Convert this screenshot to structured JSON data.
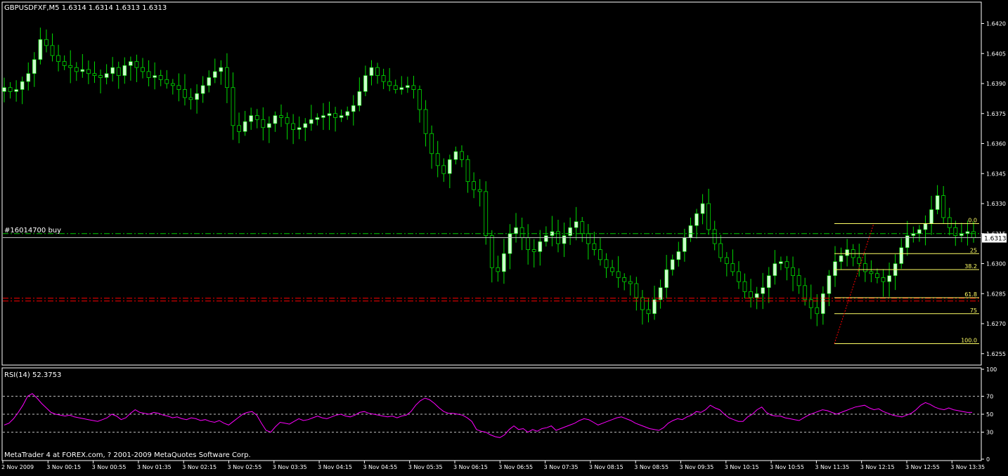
{
  "header": {
    "symbol_label": "GBPUSDFXF,M5  1.6314 1.6314 1.6313 1.6313",
    "footer": "MetaTrader 4 at FOREX.com, ? 2001-2009 MetaQuotes Software Corp."
  },
  "order_label": "#16014700 buy",
  "current_price_label": "1.6313",
  "colors": {
    "background": "#000000",
    "axis": "#ffffff",
    "bull_candle": "#ccffcc",
    "wick": "#00dd00",
    "rsi_line": "#ff00ff",
    "fibo": "#ffff66",
    "order_line": "#00cc00",
    "stop_line": "#ff0000"
  },
  "chart_data": [
    {
      "type": "candlestick",
      "title": "GBPUSDFXF,M5",
      "ylim": [
        1.625,
        1.643
      ],
      "y_ticks": [
        "1.6420",
        "1.6405",
        "1.6390",
        "1.6375",
        "1.6360",
        "1.6345",
        "1.6330",
        "1.6315",
        "1.6300",
        "1.6285",
        "1.6270",
        "1.6255"
      ],
      "x_ticks": [
        "2 Nov 2009",
        "3 Nov 00:15",
        "3 Nov 00:55",
        "3 Nov 01:35",
        "3 Nov 02:15",
        "3 Nov 02:55",
        "3 Nov 03:35",
        "3 Nov 04:15",
        "3 Nov 04:55",
        "3 Nov 05:35",
        "3 Nov 06:15",
        "3 Nov 06:55",
        "3 Nov 07:35",
        "3 Nov 08:15",
        "3 Nov 08:55",
        "3 Nov 09:35",
        "3 Nov 10:15",
        "3 Nov 10:55",
        "3 Nov 11:35",
        "3 Nov 12:15",
        "3 Nov 12:55",
        "3 Nov 13:35"
      ],
      "close_path": [
        1.6388,
        1.6386,
        1.6387,
        1.6391,
        1.6395,
        1.6402,
        1.6412,
        1.6409,
        1.6404,
        1.6401,
        1.6399,
        1.6398,
        1.6396,
        1.6397,
        1.6395,
        1.6394,
        1.6393,
        1.6395,
        1.6398,
        1.6394,
        1.6399,
        1.6401,
        1.6398,
        1.6396,
        1.6393,
        1.6394,
        1.6392,
        1.639,
        1.6389,
        1.6387,
        1.6383,
        1.6382,
        1.6385,
        1.6389,
        1.6393,
        1.6396,
        1.6398,
        1.6388,
        1.6369,
        1.6366,
        1.6371,
        1.6374,
        1.6372,
        1.6368,
        1.637,
        1.6374,
        1.6373,
        1.637,
        1.6367,
        1.6368,
        1.637,
        1.6372,
        1.6373,
        1.6374,
        1.6375,
        1.6373,
        1.6374,
        1.6376,
        1.6379,
        1.6386,
        1.6394,
        1.6398,
        1.6394,
        1.6391,
        1.6389,
        1.6387,
        1.6388,
        1.6389,
        1.6387,
        1.6377,
        1.6365,
        1.6355,
        1.6349,
        1.6345,
        1.6352,
        1.6356,
        1.6352,
        1.6341,
        1.6337,
        1.6336,
        1.6314,
        1.6298,
        1.6296,
        1.6305,
        1.6315,
        1.6318,
        1.6313,
        1.6307,
        1.6306,
        1.6311,
        1.6314,
        1.6316,
        1.631,
        1.6314,
        1.6318,
        1.6321,
        1.6315,
        1.631,
        1.6307,
        1.6302,
        1.6298,
        1.6296,
        1.6293,
        1.6291,
        1.629,
        1.6283,
        1.6277,
        1.6275,
        1.6282,
        1.6288,
        1.6297,
        1.6302,
        1.6306,
        1.6313,
        1.6319,
        1.6325,
        1.633,
        1.6317,
        1.631,
        1.6303,
        1.63,
        1.6296,
        1.6291,
        1.6286,
        1.6283,
        1.6285,
        1.6288,
        1.6294,
        1.63,
        1.6301,
        1.6298,
        1.6294,
        1.6289,
        1.6282,
        1.6278,
        1.6275,
        1.6285,
        1.6294,
        1.6301,
        1.6304,
        1.6307,
        1.6303,
        1.63,
        1.6296,
        1.6295,
        1.6293,
        1.6291,
        1.6294,
        1.63,
        1.6308,
        1.6314,
        1.6315,
        1.6317,
        1.632,
        1.6327,
        1.6334,
        1.6323,
        1.6318,
        1.6314,
        1.6315,
        1.6316,
        1.6313
      ]
    },
    {
      "type": "line",
      "title": "RSI(14) 52.3753",
      "ylim": [
        0,
        100
      ],
      "y_ticks": [
        "100",
        "70",
        "50",
        "30",
        "0"
      ],
      "levels": [
        70,
        50,
        30
      ],
      "values": [
        38,
        40,
        45,
        52,
        60,
        70,
        73,
        68,
        62,
        57,
        52,
        50,
        49,
        48,
        49,
        47,
        46,
        45,
        44,
        43,
        42,
        44,
        46,
        50,
        48,
        44,
        46,
        51,
        55,
        52,
        51,
        50,
        52,
        51,
        49,
        48,
        46,
        47,
        45,
        44,
        46,
        45,
        43,
        44,
        42,
        41,
        43,
        40,
        38,
        42,
        46,
        50,
        52,
        53,
        49,
        40,
        32,
        30,
        36,
        41,
        40,
        39,
        42,
        45,
        43,
        44,
        46,
        48,
        46,
        45,
        47,
        49,
        50,
        48,
        47,
        49,
        52,
        53,
        51,
        50,
        49,
        48,
        47,
        48,
        46,
        48,
        49,
        53,
        60,
        65,
        68,
        66,
        62,
        57,
        53,
        51,
        51,
        50,
        49,
        46,
        42,
        33,
        31,
        30,
        27,
        25,
        24,
        27,
        33,
        37,
        33,
        34,
        30,
        33,
        31,
        34,
        35,
        37,
        32,
        34,
        36,
        38,
        40,
        43,
        45,
        44,
        41,
        38,
        40,
        42,
        44,
        46,
        47,
        45,
        43,
        40,
        38,
        36,
        34,
        33,
        32,
        35,
        40,
        43,
        45,
        44,
        47,
        49,
        53,
        52,
        55,
        60,
        57,
        55,
        50,
        46,
        44,
        42,
        42,
        47,
        50,
        55,
        58,
        52,
        49,
        48,
        48,
        46,
        45,
        44,
        43,
        46,
        49,
        51,
        53,
        55,
        54,
        52,
        50,
        52,
        54,
        56,
        58,
        59,
        60,
        57,
        55,
        56,
        53,
        51,
        49,
        48,
        47,
        49,
        51,
        55,
        60,
        63,
        61,
        58,
        56,
        55,
        57,
        55,
        54,
        53,
        52,
        52
      ]
    }
  ],
  "fibonacci": {
    "levels": [
      {
        "label": "0.0",
        "price": 1.632
      },
      {
        "label": "25",
        "price": 1.6305
      },
      {
        "label": "38.2",
        "price": 1.6297
      },
      {
        "label": "61.8",
        "price": 1.6283
      },
      {
        "label": "75",
        "price": 1.6275
      },
      {
        "label": "100.0",
        "price": 1.626
      }
    ]
  },
  "order_price": 1.6315,
  "stop_price": 1.6282,
  "current_price": 1.6313
}
